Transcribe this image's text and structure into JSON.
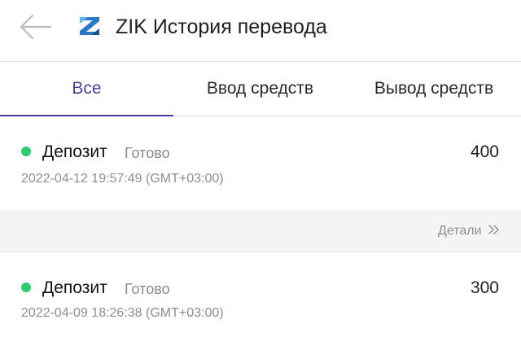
{
  "header": {
    "title": "ZIK История перевода",
    "back_icon": "arrow-left-icon",
    "logo_icon": "zik-logo-icon",
    "brand_color": "#2a78c9"
  },
  "tabs": [
    {
      "label": "Все",
      "active": true
    },
    {
      "label": "Ввод средств",
      "active": false
    },
    {
      "label": "Вывод средств",
      "active": false
    }
  ],
  "accent_color": "#4b3f9e",
  "status_color": "#2ecc71",
  "records": [
    {
      "type": "Депозит",
      "status": "Готово",
      "amount": "400",
      "time": "2022-04-12 19:57:49 (GMT+03:00)"
    },
    {
      "type": "Депозит",
      "status": "Готово",
      "amount": "300",
      "time": "2022-04-09 18:26:38 (GMT+03:00)"
    }
  ],
  "details": {
    "label": "Детали",
    "icon": "double-chevron-right-icon"
  }
}
